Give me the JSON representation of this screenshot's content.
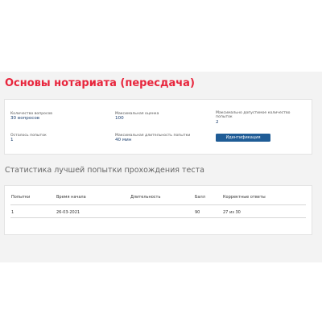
{
  "title": "Основы нотариата (пересдача)",
  "info": {
    "questions_count": {
      "label": "Количество вопросов",
      "value": "30 вопросов"
    },
    "max_score": {
      "label": "Максимальная оценка",
      "value": "100"
    },
    "max_attempts": {
      "label": "Максимально допустимое количество попыток",
      "value": "2"
    },
    "attempts_left": {
      "label": "Осталось попыток",
      "value": "1"
    },
    "max_duration": {
      "label": "Максимальная длительность попытки",
      "value": "40 мин"
    },
    "identify_button": "Идентификация"
  },
  "stats": {
    "heading": "Статистика лучшей попытки прохождения теста",
    "columns": [
      "Попытки",
      "Время начала",
      "Длительность",
      "Балл",
      "Корректные ответы"
    ],
    "rows": [
      [
        "1",
        "26-03-2021",
        "",
        "90",
        "27 из 30"
      ]
    ]
  },
  "colors": {
    "title": "#e8253c",
    "button": "#1f5c96",
    "value_text": "#1c3f6e"
  }
}
